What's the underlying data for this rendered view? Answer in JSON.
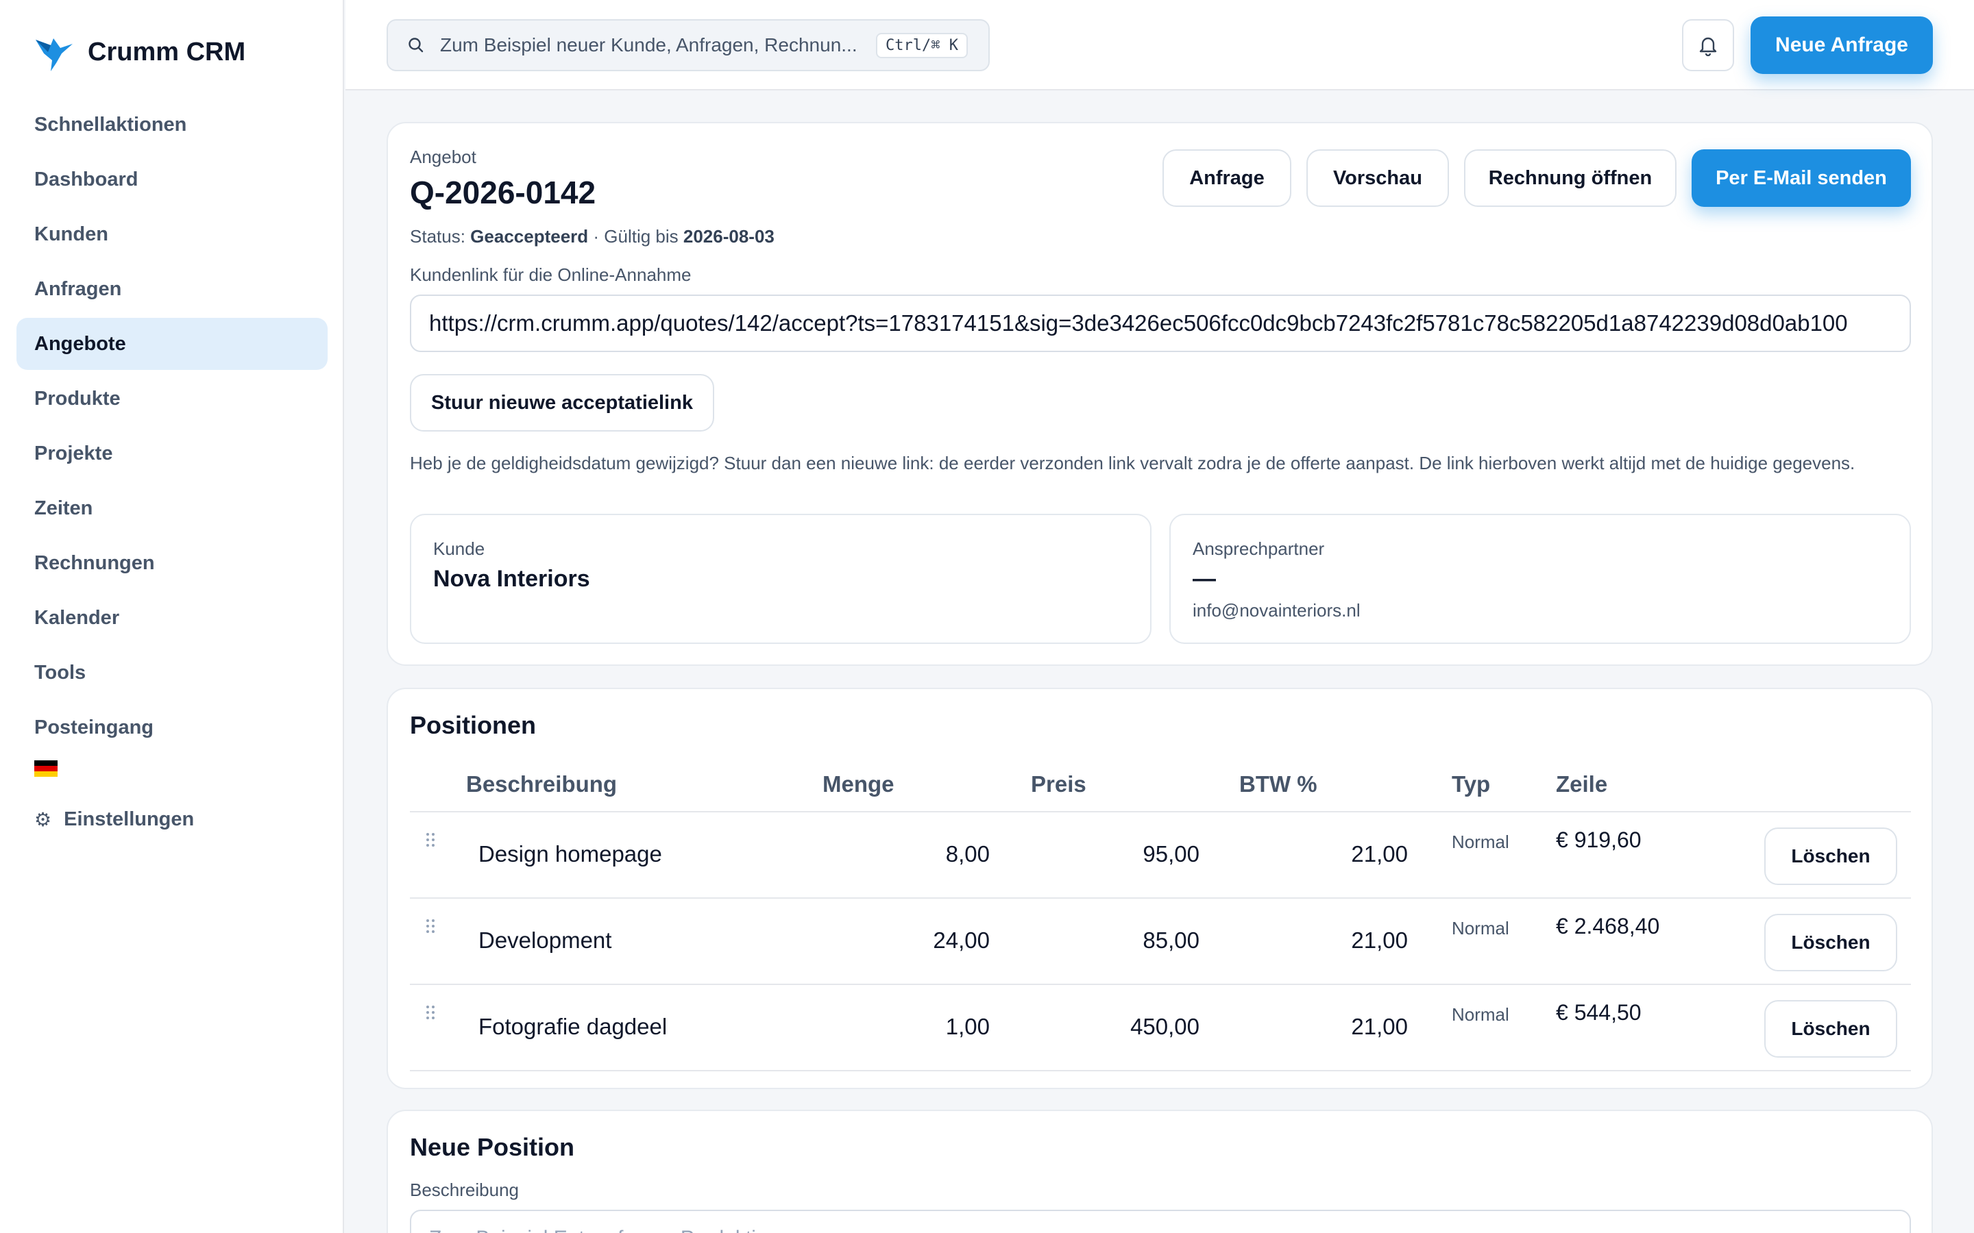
{
  "app": {
    "name": "Crumm CRM",
    "brand_color": "#1d8fe1"
  },
  "sidebar": {
    "items": [
      {
        "label": "Schnellaktionen"
      },
      {
        "label": "Dashboard"
      },
      {
        "label": "Kunden"
      },
      {
        "label": "Anfragen"
      },
      {
        "label": "Angebote",
        "active": true
      },
      {
        "label": "Produkte"
      },
      {
        "label": "Projekte"
      },
      {
        "label": "Zeiten"
      },
      {
        "label": "Rechnungen"
      },
      {
        "label": "Kalender"
      },
      {
        "label": "Tools"
      },
      {
        "label": "Posteingang"
      }
    ],
    "language_flag": "german-flag-icon",
    "settings_label": "Einstellungen",
    "settings_icon": "⚙"
  },
  "topbar": {
    "search_placeholder": "Zum Beispiel neuer Kunde, Anfragen, Rechnun...",
    "search_shortcut": "Ctrl/⌘ K",
    "new_request_label": "Neue Anfrage"
  },
  "quote": {
    "type_label": "Angebot",
    "number": "Q-2026-0142",
    "status_label": "Status:",
    "status_value": "Geaccepteerd",
    "valid_label": "· Gültig bis",
    "valid_until": "2026-08-03",
    "actions": {
      "request": "Anfrage",
      "preview": "Vorschau",
      "open_invoice": "Rechnung öffnen",
      "send_email": "Per E-Mail senden"
    },
    "link_label": "Kundenlink für die Online-Annahme",
    "link_value": "https://crm.crumm.app/quotes/142/accept?ts=1783174151&sig=3de3426ec506fcc0dc9bcb7243fc2f5781c78c582205d1a8742239d08d0ab100",
    "resend_label": "Stuur nieuwe acceptatielink",
    "note": "Heb je de geldigheidsdatum gewijzigd? Stuur dan een nieuwe link: de eerder verzonden link vervalt zodra je de offerte aanpast. De link hierboven werkt altijd met de huidige gegevens.",
    "customer_label": "Kunde",
    "customer_name": "Nova Interiors",
    "contact_label": "Ansprechpartner",
    "contact_name": "—",
    "contact_email": "info@novainteriors.nl"
  },
  "positions": {
    "title": "Positionen",
    "columns": {
      "description": "Beschreibung",
      "quantity": "Menge",
      "price": "Preis",
      "vat": "BTW %",
      "type": "Typ",
      "line": "Zeile"
    },
    "rows": [
      {
        "description": "Design homepage",
        "quantity": "8,00",
        "price": "95,00",
        "vat": "21,00",
        "type": "Normal",
        "line": "€ 919,60",
        "delete": "Löschen"
      },
      {
        "description": "Development",
        "quantity": "24,00",
        "price": "85,00",
        "vat": "21,00",
        "type": "Normal",
        "line": "€ 2.468,40",
        "delete": "Löschen"
      },
      {
        "description": "Fotografie dagdeel",
        "quantity": "1,00",
        "price": "450,00",
        "vat": "21,00",
        "type": "Normal",
        "line": "€ 544,50",
        "delete": "Löschen"
      }
    ]
  },
  "new_position": {
    "title": "Neue Position",
    "description_label": "Beschreibung",
    "description_placeholder": "Zum Beispiel Entwurf neue Produktion"
  }
}
